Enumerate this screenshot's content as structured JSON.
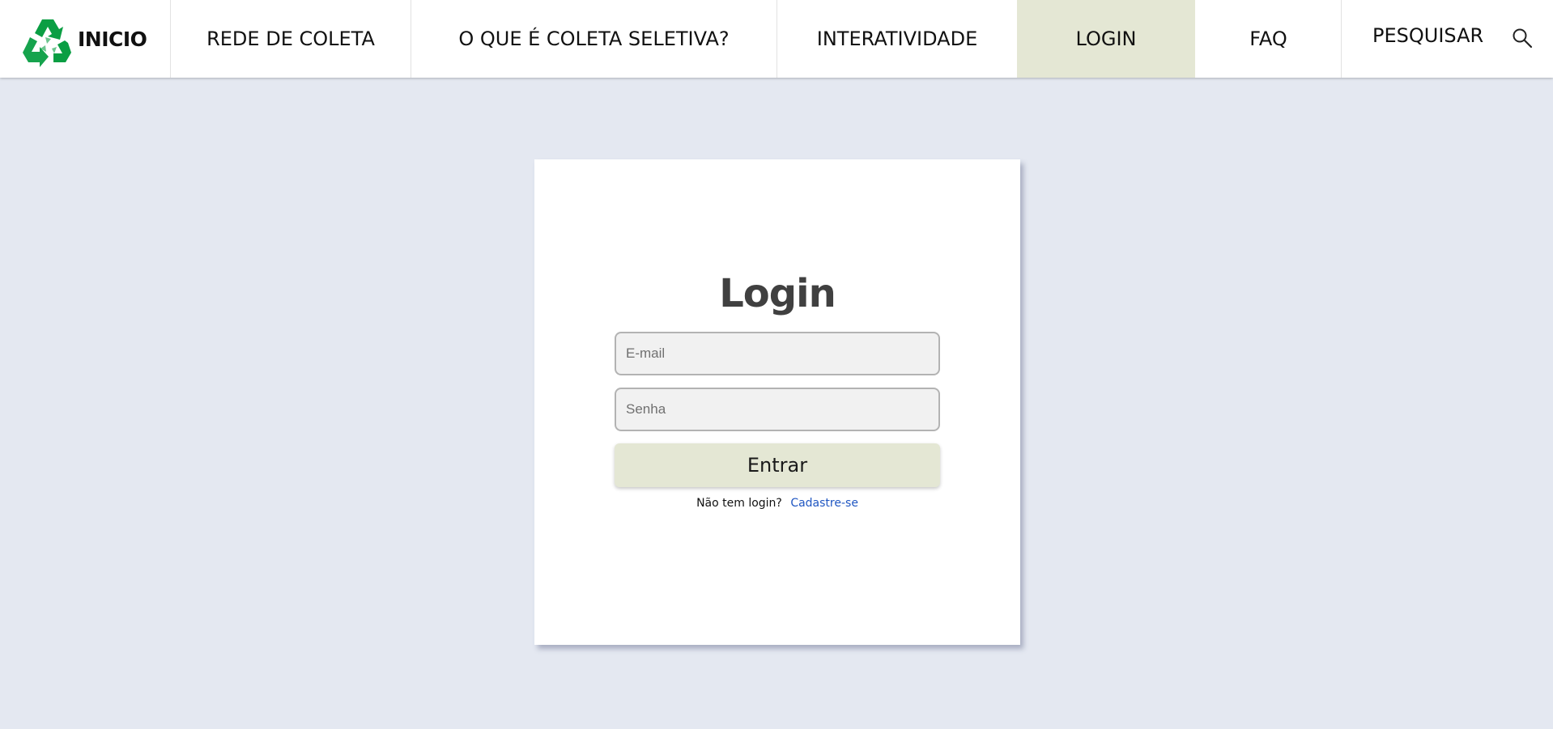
{
  "nav": {
    "home_label": "INICIO",
    "items": [
      {
        "label": "REDE DE COLETA"
      },
      {
        "label": "O QUE É COLETA SELETIVA?"
      },
      {
        "label": "INTERATIVIDADE"
      },
      {
        "label": "LOGIN",
        "active": true
      },
      {
        "label": "FAQ"
      }
    ],
    "search_label": "PESQUISAR",
    "search_icon": "magnifier-icon",
    "logo_icon": "recycle-logo-icon",
    "active_color": "#e4e7d4",
    "logo_color": "#0a9e43"
  },
  "login": {
    "title": "Login",
    "email_placeholder": "E-mail",
    "password_placeholder": "Senha",
    "submit_label": "Entrar",
    "signup_prompt": "Não tem login?",
    "signup_link": "Cadastre-se",
    "link_color": "#1f56c2"
  },
  "page": {
    "background_color": "#e4e8f1"
  }
}
